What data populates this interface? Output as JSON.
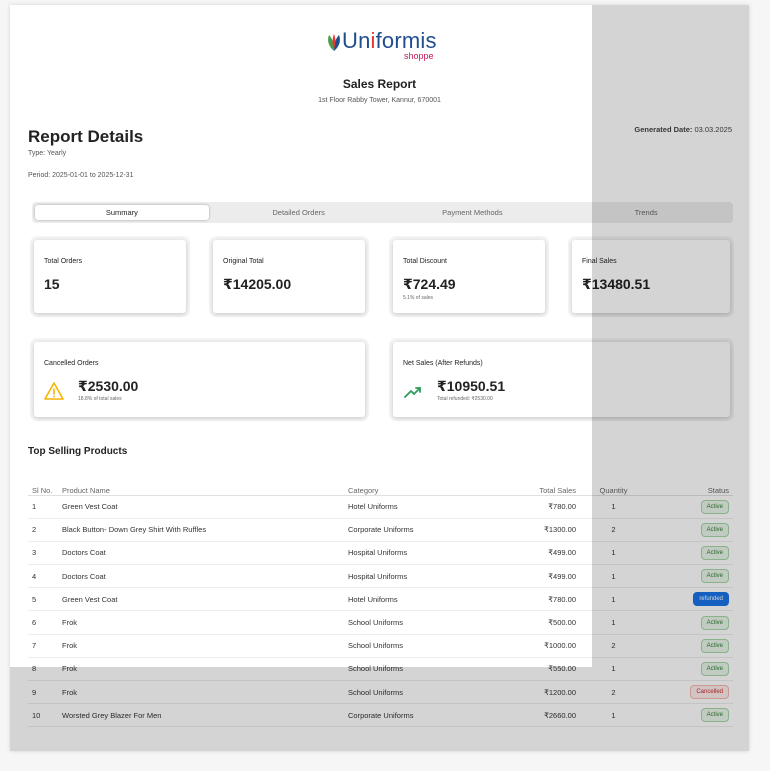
{
  "brand": {
    "name_part1": "Un",
    "name_dot_letter": "i",
    "name_part2": "formis",
    "sub": "shoppe",
    "colors": {
      "primary": "#1f4e8f",
      "accent_pink": "#c2185b",
      "accent_green": "#43a047",
      "accent_red": "#e53935"
    }
  },
  "header": {
    "title": "Sales Report",
    "address": "1st Floor Rabby Tower, Kannur, 670001"
  },
  "details": {
    "heading": "Report Details",
    "type": "Type: Yearly",
    "period": "Period: 2025-01-01 to 2025-12-31",
    "generated_label": "Generated Date:",
    "generated_value": "03.03.2025"
  },
  "tabs": [
    {
      "label": "Summary",
      "active": true
    },
    {
      "label": "Detailed Orders",
      "active": false
    },
    {
      "label": "Payment Methods",
      "active": false
    },
    {
      "label": "Trends",
      "active": false
    }
  ],
  "stats": {
    "total_orders": {
      "label": "Total Orders",
      "value": "15"
    },
    "original_total": {
      "label": "Original Total",
      "value": "₹14205.00"
    },
    "total_discount": {
      "label": "Total Discount",
      "value": "₹724.49",
      "sub": "5.1% of sales"
    },
    "final_sales": {
      "label": "Final Sales",
      "value": "₹13480.51"
    },
    "cancelled_orders": {
      "label": "Cancelled Orders",
      "value": "₹2530.00",
      "sub": "18.8% of total sales",
      "icon": "warning-icon"
    },
    "net_sales": {
      "label": "Net Sales (After Refunds)",
      "value": "₹10950.51",
      "sub": "Total refunded: ₹2530.00",
      "icon": "trending-up-icon"
    }
  },
  "products": {
    "title": "Top Selling Products",
    "columns": [
      "Sl No.",
      "Product Name",
      "Category",
      "Total Sales",
      "Quantity",
      "Status"
    ],
    "rows": [
      {
        "sl": "1",
        "name": "Green Vest Coat",
        "category": "Hotel Uniforms",
        "sales": "₹780.00",
        "qty": "1",
        "status": "Active"
      },
      {
        "sl": "2",
        "name": "Black Button- Down Grey Shirt With Ruffles",
        "category": "Corporate Uniforms",
        "sales": "₹1300.00",
        "qty": "2",
        "status": "Active"
      },
      {
        "sl": "3",
        "name": "Doctors Coat",
        "category": "Hospital Uniforms",
        "sales": "₹499.00",
        "qty": "1",
        "status": "Active"
      },
      {
        "sl": "4",
        "name": "Doctors Coat",
        "category": "Hospital Uniforms",
        "sales": "₹499.00",
        "qty": "1",
        "status": "Active"
      },
      {
        "sl": "5",
        "name": "Green Vest Coat",
        "category": "Hotel Uniforms",
        "sales": "₹780.00",
        "qty": "1",
        "status": "refunded"
      },
      {
        "sl": "6",
        "name": "Frok",
        "category": "School Uniforms",
        "sales": "₹500.00",
        "qty": "1",
        "status": "Active"
      },
      {
        "sl": "7",
        "name": "Frok",
        "category": "School Uniforms",
        "sales": "₹1000.00",
        "qty": "2",
        "status": "Active"
      },
      {
        "sl": "8",
        "name": "Frok",
        "category": "School Uniforms",
        "sales": "₹550.00",
        "qty": "1",
        "status": "Active"
      },
      {
        "sl": "9",
        "name": "Frok",
        "category": "School Uniforms",
        "sales": "₹1200.00",
        "qty": "2",
        "status": "Cancelled"
      },
      {
        "sl": "10",
        "name": "Worsted Grey Blazer For Men",
        "category": "Corporate Uniforms",
        "sales": "₹2660.00",
        "qty": "1",
        "status": "Active"
      }
    ]
  }
}
